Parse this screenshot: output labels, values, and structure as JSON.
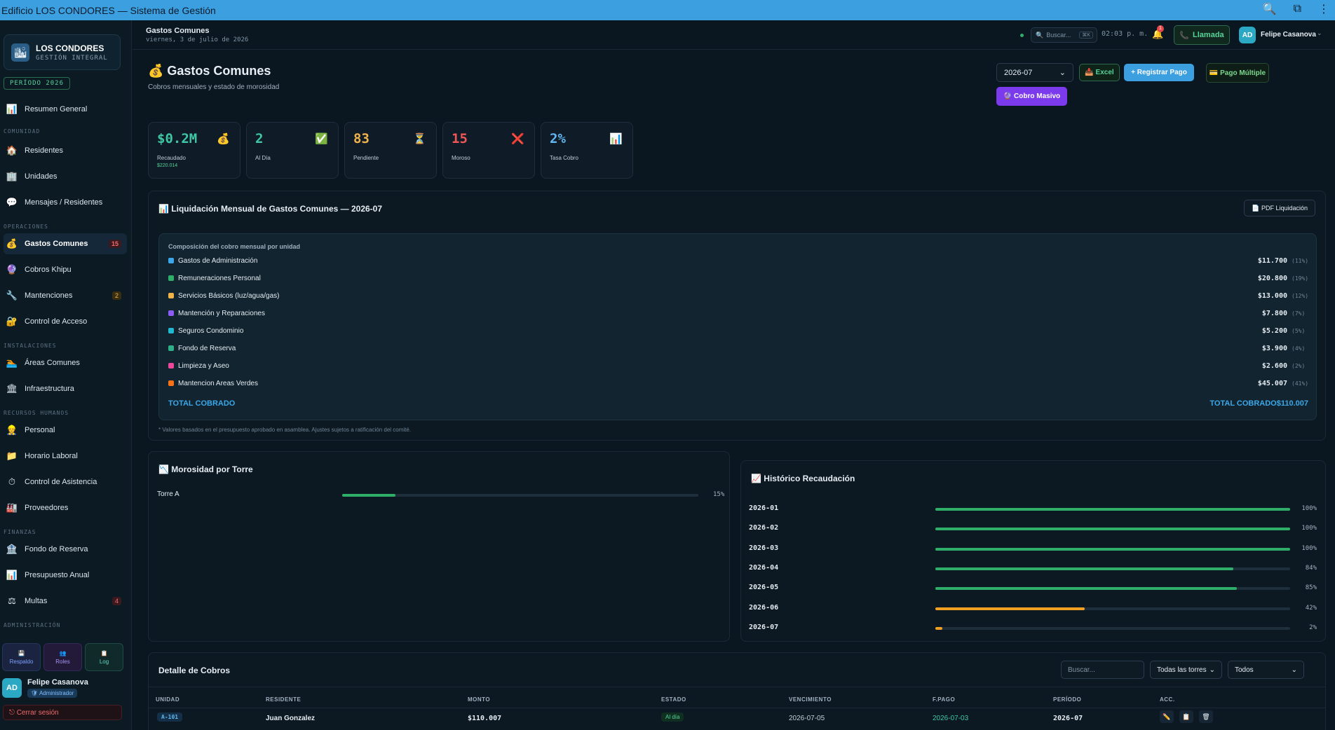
{
  "window": {
    "title": "Edificio LOS CONDORES — Sistema de Gestión"
  },
  "brand": {
    "name": "LOS CONDORES",
    "subtitle": "GESTIÓN INTEGRAL",
    "period": "PERÍODO 2026"
  },
  "sidebar": {
    "items": [
      {
        "label": "Resumen General",
        "icon": "📊"
      },
      {
        "label": "Residentes",
        "icon": "🏠"
      },
      {
        "label": "Unidades",
        "icon": "🏢"
      },
      {
        "label": "Mensajes / Residentes",
        "icon": "💬"
      },
      {
        "label": "Gastos Comunes",
        "icon": "💰",
        "badge": "15"
      },
      {
        "label": "Cobros Khipu",
        "icon": "🔮"
      },
      {
        "label": "Mantenciones",
        "icon": "🔧",
        "badge": "2"
      },
      {
        "label": "Control de Acceso",
        "icon": "🔐"
      },
      {
        "label": "Áreas Comunes",
        "icon": "🏊"
      },
      {
        "label": "Infraestructura",
        "icon": "🏛"
      },
      {
        "label": "Personal",
        "icon": "👷"
      },
      {
        "label": "Horario Laboral",
        "icon": "📁"
      },
      {
        "label": "Control de Asistencia",
        "icon": "⏱"
      },
      {
        "label": "Proveedores",
        "icon": "🏭"
      },
      {
        "label": "Fondo de Reserva",
        "icon": "🏦"
      },
      {
        "label": "Presupuesto Anual",
        "icon": "📊"
      },
      {
        "label": "Multas",
        "icon": "⚖",
        "badge": "4"
      }
    ],
    "sections": [
      "COMUNIDAD",
      "OPERACIONES",
      "INSTALACIONES",
      "RECURSOS HUMANOS",
      "FINANZAS",
      "ADMINISTRACIÓN"
    ],
    "buttons": [
      {
        "label": "Respaldo",
        "icon": "💾"
      },
      {
        "label": "Roles",
        "icon": "👥"
      },
      {
        "label": "Log",
        "icon": "📋"
      }
    ],
    "user": {
      "initials": "AD",
      "name": "Felipe Casanova",
      "role": "🛡 Administrador"
    },
    "logout": "⎋ Cerrar sesión"
  },
  "header": {
    "title": "Gastos Comunes",
    "date": "viernes, 3 de julio de 2026",
    "search_placeholder": "Buscar...",
    "search_kbd": "⌘K",
    "clock": "02:03 p. m.",
    "notif_count": "1",
    "call_label": "Llamada",
    "user_initials": "AD",
    "user_name": "Felipe Casanova"
  },
  "page": {
    "title": "💰 Gastos Comunes",
    "subtitle": "Cobros mensuales y estado de morosidad",
    "period_value": "2026-07",
    "btn_excel": "📥 Excel",
    "btn_register": "+ Registrar Pago",
    "btn_multi": "💳 Pago Múltiple",
    "btn_massive": "🔮 Cobro Masivo"
  },
  "kpis": [
    {
      "value": "$0.2M",
      "label": "Recaudado",
      "sub": "$220.014",
      "icon": "💰",
      "color": "#3ec7a4"
    },
    {
      "value": "2",
      "label": "Al Día",
      "sub": "",
      "icon": "✅",
      "color": "#3ec7a4"
    },
    {
      "value": "83",
      "label": "Pendiente",
      "sub": "",
      "icon": "⏳",
      "color": "#f0b34a"
    },
    {
      "value": "15",
      "label": "Moroso",
      "sub": "",
      "icon": "❌",
      "color": "#f05656"
    },
    {
      "value": "2%",
      "label": "Tasa Cobro",
      "sub": "",
      "icon": "📊",
      "color": "#5fb6f0"
    }
  ],
  "liquidacion": {
    "title": "📊 Liquidación Mensual de Gastos Comunes — 2026-07",
    "pdf_button": "📄 PDF Liquidación",
    "composition_title": "Composición del cobro mensual por unidad",
    "rows": [
      {
        "label": "Gastos de Administración",
        "amount": "$11.700",
        "pct": "(11%)",
        "color": "#3ba7e8"
      },
      {
        "label": "Remuneraciones Personal",
        "amount": "$20.800",
        "pct": "(19%)",
        "color": "#2fae6a"
      },
      {
        "label": "Servicios Básicos (luz/agua/gas)",
        "amount": "$13.000",
        "pct": "(12%)",
        "color": "#f0b34a"
      },
      {
        "label": "Mantención y Reparaciones",
        "amount": "$7.800",
        "pct": "(7%)",
        "color": "#8b5cf6"
      },
      {
        "label": "Seguros Condominio",
        "amount": "$5.200",
        "pct": "(5%)",
        "color": "#22b8cf"
      },
      {
        "label": "Fondo de Reserva",
        "amount": "$3.900",
        "pct": "(4%)",
        "color": "#2fae8a"
      },
      {
        "label": "Limpieza y Aseo",
        "amount": "$2.600",
        "pct": "(2%)",
        "color": "#ec4899"
      },
      {
        "label": "Mantencion Areas Verdes",
        "amount": "$45.007",
        "pct": "(41%)",
        "color": "#f97316"
      }
    ],
    "total_label": "TOTAL COBRADO",
    "total_right": "TOTAL COBRADO$110.007",
    "footnote": "* Valores basados en el presupuesto aprobado en asamblea. Ajustes sujetos a ratificación del comité."
  },
  "morosidad": {
    "title": "📉 Morosidad por Torre",
    "rows": [
      {
        "label": "Torre A",
        "value": 15,
        "pct_label": "15%"
      }
    ]
  },
  "historico": {
    "title": "📈 Histórico Recaudación",
    "rows": [
      {
        "period": "2026-01",
        "value": 100,
        "pct_label": "100%",
        "color": "#2fae6a"
      },
      {
        "period": "2026-02",
        "value": 100,
        "pct_label": "100%",
        "color": "#2fae6a"
      },
      {
        "period": "2026-03",
        "value": 100,
        "pct_label": "100%",
        "color": "#2fae6a"
      },
      {
        "period": "2026-04",
        "value": 84,
        "pct_label": "84%",
        "color": "#2fae6a"
      },
      {
        "period": "2026-05",
        "value": 85,
        "pct_label": "85%",
        "color": "#2fae6a"
      },
      {
        "period": "2026-06",
        "value": 42,
        "pct_label": "42%",
        "color": "#f0a020"
      },
      {
        "period": "2026-07",
        "value": 2,
        "pct_label": "2%",
        "color": "#f0a020"
      }
    ]
  },
  "detalle": {
    "title": "Detalle de Cobros",
    "search_placeholder": "Buscar...",
    "tower_filter": "Todas las torres",
    "status_filter": "Todos",
    "columns": [
      "UNIDAD",
      "RESIDENTE",
      "MONTO",
      "ESTADO",
      "VENCIMIENTO",
      "F.PAGO",
      "PERÍODO",
      "ACC."
    ],
    "rows": [
      {
        "unit": "A-101",
        "resident": "Juan Gonzalez",
        "amount": "$110.007",
        "status": "Al día",
        "due": "2026-07-05",
        "paid": "2026-07-03",
        "period": "2026-07"
      }
    ],
    "actions": [
      "✏️",
      "📋",
      "🗑"
    ]
  }
}
